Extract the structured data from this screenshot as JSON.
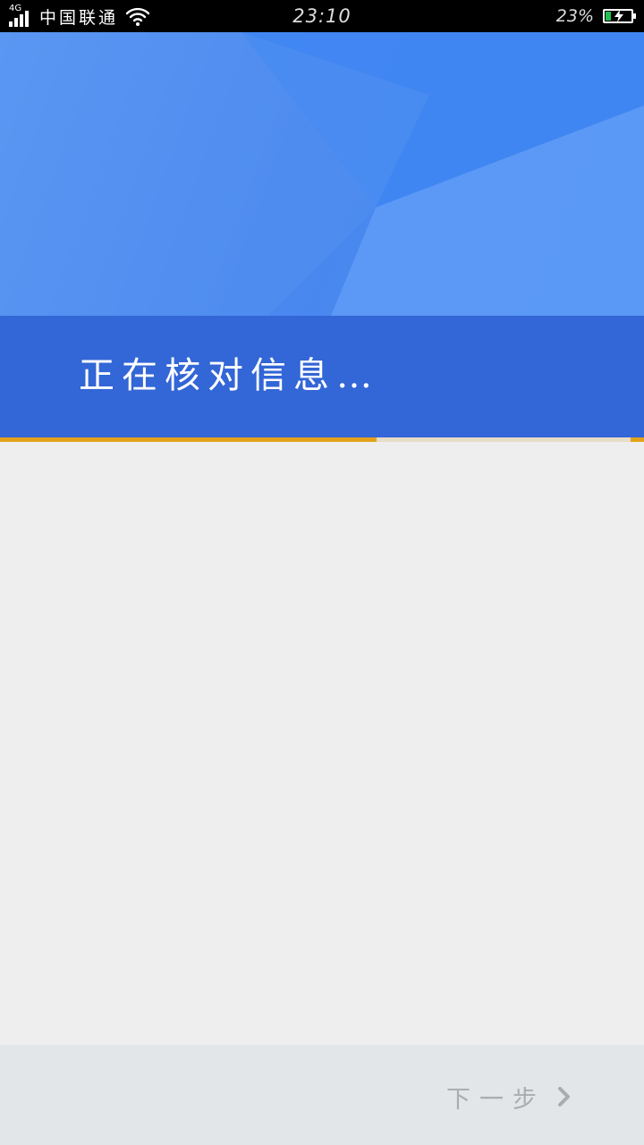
{
  "status_bar": {
    "network_type": "4G",
    "carrier": "中国联通",
    "time": "23:10",
    "battery_percent": "23%",
    "battery_level": 0.23,
    "icons": [
      "signal-icon",
      "wifi-icon",
      "battery-icon",
      "charging-icon"
    ]
  },
  "header": {
    "title": "正在核对信息…"
  },
  "progress": {
    "value": 0.585
  },
  "footer": {
    "next_label": "下一步",
    "next_icon": "chevron-right-icon"
  },
  "colors": {
    "header_blue": "#4a88ee",
    "band_blue": "#3366d6",
    "progress": "#e3a21a",
    "footer_bg": "#e2e6e9",
    "next_text": "#a9adb0"
  }
}
